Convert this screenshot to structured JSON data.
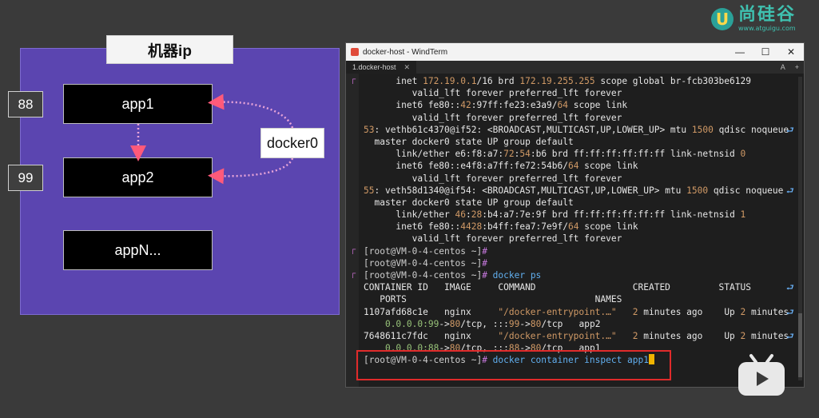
{
  "diagram": {
    "machine_label": "机器ip",
    "apps": [
      "app1",
      "app2",
      "appN..."
    ],
    "ports": [
      "88",
      "99"
    ],
    "bridge_label": "docker0",
    "colors": {
      "machine": "#5b45b0",
      "arrow": "#e8a4d8"
    }
  },
  "logo": {
    "name": "尚硅谷",
    "url_text": "www.atguigu.com"
  },
  "window": {
    "title": "docker-host - WindTerm",
    "controls": [
      "—",
      "☐",
      "✕"
    ],
    "tab_label": "1.docker-host",
    "tab_right_icons": [
      "A",
      "+"
    ]
  },
  "terminal": {
    "lines": [
      [
        [
          "plain",
          "      inet "
        ],
        [
          "num",
          "172.19.0.1"
        ],
        [
          "plain",
          "/16 brd "
        ],
        [
          "num",
          "172.19.255.255"
        ],
        [
          "plain",
          " scope global br-fcb303be6129"
        ]
      ],
      [
        [
          "plain",
          "         valid_lft forever preferred_lft forever"
        ]
      ],
      [
        [
          "plain",
          "      inet6 fe80::"
        ],
        [
          "num",
          "42"
        ],
        [
          "plain",
          ":97ff:fe23:e3a9/"
        ],
        [
          "num",
          "64"
        ],
        [
          "plain",
          " scope link"
        ]
      ],
      [
        [
          "plain",
          "         valid_lft forever preferred_lft forever"
        ]
      ],
      [
        [
          "num",
          "53"
        ],
        [
          "plain",
          ": vethb61c4370@if52: <BROADCAST,MULTICAST,UP,LOWER_UP> mtu "
        ],
        [
          "num",
          "1500"
        ],
        [
          "plain",
          " qdisc noqueue"
        ]
      ],
      [
        [
          "plain",
          "  master docker0 state UP group default"
        ]
      ],
      [
        [
          "plain",
          "      link/ether e6:f8:a7:"
        ],
        [
          "num",
          "72"
        ],
        [
          "plain",
          ":"
        ],
        [
          "num",
          "54"
        ],
        [
          "plain",
          ":b6 brd ff:ff:ff:ff:ff:ff link-netnsid "
        ],
        [
          "num",
          "0"
        ]
      ],
      [
        [
          "plain",
          "      inet6 fe80::e4f8:a7ff:fe72:54b6/"
        ],
        [
          "num",
          "64"
        ],
        [
          "plain",
          " scope link"
        ]
      ],
      [
        [
          "plain",
          "         valid_lft forever preferred_lft forever"
        ]
      ],
      [
        [
          "num",
          "55"
        ],
        [
          "plain",
          ": veth58d1340@if54: <BROADCAST,MULTICAST,UP,LOWER_UP> mtu "
        ],
        [
          "num",
          "1500"
        ],
        [
          "plain",
          " qdisc noqueue"
        ]
      ],
      [
        [
          "plain",
          "  master docker0 state UP group default"
        ]
      ],
      [
        [
          "plain",
          "      link/ether "
        ],
        [
          "num",
          "46"
        ],
        [
          "plain",
          ":"
        ],
        [
          "num",
          "28"
        ],
        [
          "plain",
          ":b4:a7:7e:9f brd ff:ff:ff:ff:ff:ff link-netnsid "
        ],
        [
          "num",
          "1"
        ]
      ],
      [
        [
          "plain",
          "      inet6 fe80::"
        ],
        [
          "num",
          "4428"
        ],
        [
          "plain",
          ":b4ff:fea7:7e9f/"
        ],
        [
          "num",
          "64"
        ],
        [
          "plain",
          " scope link"
        ]
      ],
      [
        [
          "plain",
          "         valid_lft forever preferred_lft forever"
        ]
      ],
      [
        [
          "prompt",
          "[root@VM-0-4-centos ~]"
        ],
        [
          "purple",
          "#"
        ]
      ],
      [
        [
          "prompt",
          "[root@VM-0-4-centos ~]"
        ],
        [
          "purple",
          "#"
        ]
      ],
      [
        [
          "prompt",
          "[root@VM-0-4-centos ~]"
        ],
        [
          "purple",
          "#"
        ],
        [
          "cmd",
          " docker ps"
        ]
      ],
      [
        [
          "plain",
          "CONTAINER ID   IMAGE     COMMAND                  CREATED         STATUS"
        ]
      ],
      [
        [
          "plain",
          "   PORTS                                   NAMES"
        ]
      ],
      [
        [
          "plain",
          "1107afd68c1e   nginx     "
        ],
        [
          "num",
          "\"/docker-entrypoint.…\""
        ],
        [
          "plain",
          "   "
        ],
        [
          "num",
          "2"
        ],
        [
          "plain",
          " minutes ago    Up "
        ],
        [
          "num",
          "2"
        ],
        [
          "plain",
          " minutes"
        ]
      ],
      [
        [
          "plain",
          "    "
        ],
        [
          "mac",
          "0.0.0.0:99"
        ],
        [
          "plain",
          "->"
        ],
        [
          "num",
          "80"
        ],
        [
          "plain",
          "/tcp, :::"
        ],
        [
          "num",
          "99"
        ],
        [
          "plain",
          "->"
        ],
        [
          "num",
          "80"
        ],
        [
          "plain",
          "/tcp   app2"
        ]
      ],
      [
        [
          "plain",
          "7648611c7fdc   nginx     "
        ],
        [
          "num",
          "\"/docker-entrypoint.…\""
        ],
        [
          "plain",
          "   "
        ],
        [
          "num",
          "2"
        ],
        [
          "plain",
          " minutes ago    Up "
        ],
        [
          "num",
          "2"
        ],
        [
          "plain",
          " minutes"
        ]
      ],
      [
        [
          "plain",
          "    "
        ],
        [
          "mac",
          "0.0.0.0:88"
        ],
        [
          "plain",
          "->"
        ],
        [
          "num",
          "80"
        ],
        [
          "plain",
          "/tcp, :::"
        ],
        [
          "num",
          "88"
        ],
        [
          "plain",
          "->"
        ],
        [
          "num",
          "80"
        ],
        [
          "plain",
          "/tcp   app1"
        ]
      ],
      [
        [
          "prompt",
          "[root@VM-0-4-centos ~]"
        ],
        [
          "purple",
          "#"
        ],
        [
          "cmd",
          " docker container inspect app1"
        ],
        [
          "cursor",
          ""
        ]
      ]
    ],
    "wrapped_line_indices": [
      4,
      9,
      17,
      19,
      21
    ],
    "gutter_mark_line_indices": [
      0,
      14,
      16
    ]
  }
}
